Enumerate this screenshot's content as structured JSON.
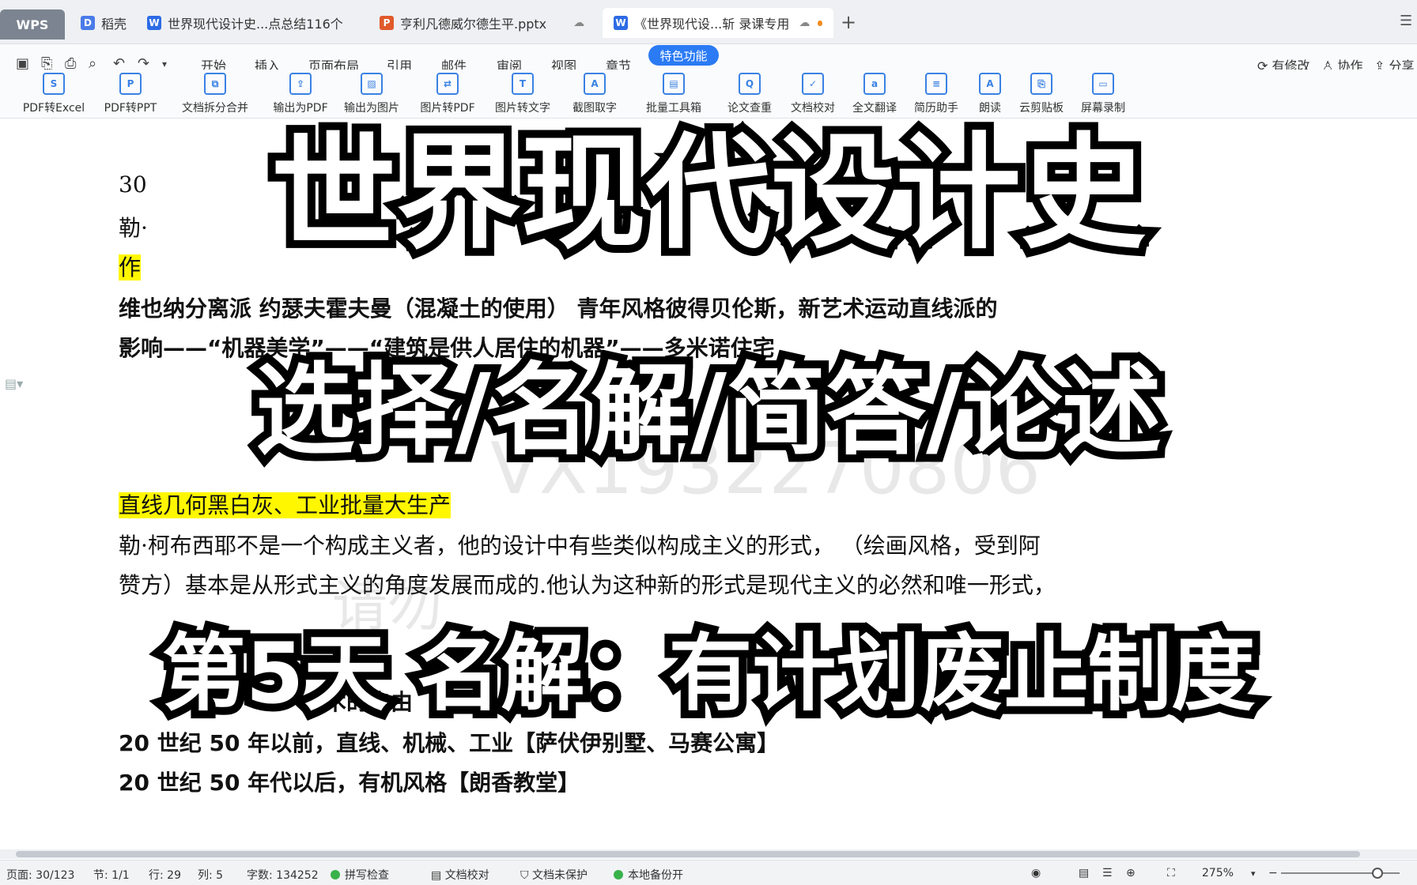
{
  "tabs": {
    "wps": "WPS",
    "daoke": "稻壳",
    "doc1": "世界现代设计史...点总结116个",
    "ppt": "亨利凡德威尔德生平.pptx",
    "active": "《世界现代设...斩 录课专用"
  },
  "menu": {
    "items": [
      "开始",
      "插入",
      "页面布局",
      "引用",
      "邮件",
      "审阅",
      "视图",
      "章节"
    ],
    "special": "特色功能",
    "modified": "有修改",
    "collab": "协作",
    "share": "分享"
  },
  "ribbon": [
    "PDF转Excel",
    "PDF转PPT",
    "文档拆分合并",
    "输出为PDF",
    "输出为图片",
    "图片转PDF",
    "图片转文字",
    "截图取字",
    "批量工具箱",
    "论文查重",
    "文档校对",
    "全文翻译",
    "简历助手",
    "朗读",
    "云剪贴板",
    "屏幕录制"
  ],
  "document": {
    "line1": "30",
    "line2": "勒·",
    "line3": "作",
    "line4": "维也纳分离派 约瑟夫霍夫曼（混凝土的使用） 青年风格彼得贝伦斯，新艺术运动直线派的",
    "line5": "影响——“机器美学”——“建筑是供人居住的机器”——多米诺住宅",
    "line6": "直线几何黑白灰、工业批量大生产",
    "line7": "勒·柯布西耶不是一个构成主义者，他的设计中有些类似构成主义的形式， （绘画风格，受到阿",
    "line8": "赞方）基本是从形式主义的角度发展而成的.他认为这种新的形式是现代主义的必然和唯一形式，",
    "line9": "术的自由",
    "line10": "20 世纪 50 年以前，直线、机械、工业【萨伏伊别墅、马赛公寓】",
    "line11": "20 世纪 50 年代以后，有机风格【朗香教堂】",
    "watermark_id": "VX1932270806",
    "watermark_text": "请勿"
  },
  "overlay": {
    "title": "世界现代设计史",
    "subtitle": "选择/名解/简答/论述",
    "day": "第5天  名解：有计划废止制度"
  },
  "status": {
    "page": "页面: 30/123",
    "section": "节: 1/1",
    "row": "行: 29",
    "col": "列: 5",
    "words": "字数: 134252",
    "spell": "拼写检查",
    "proof": "文档校对",
    "protect": "文档未保护",
    "backup": "本地备份开",
    "zoom": "275%"
  },
  "colors": {
    "accent": "#2b7bf5",
    "highlight": "#fff700"
  }
}
